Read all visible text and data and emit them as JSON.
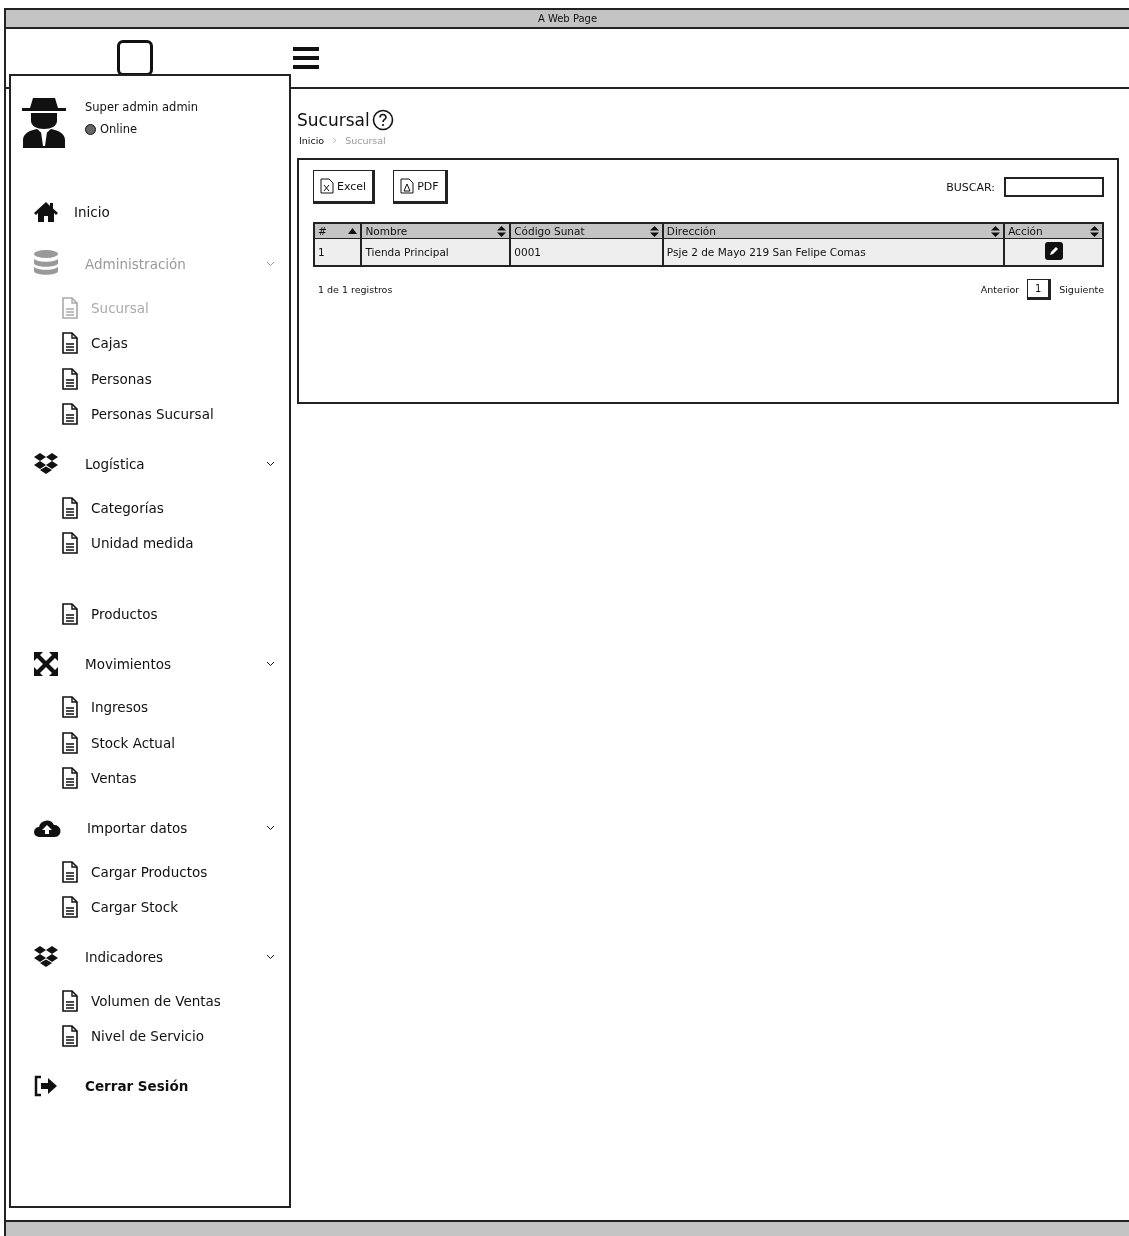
{
  "window": {
    "title": "A Web Page"
  },
  "user": {
    "name": "Super admin admin",
    "status": "Online"
  },
  "sidebar": {
    "items": [
      {
        "kind": "link",
        "label": "Inicio"
      },
      {
        "kind": "group",
        "label": "Administración",
        "selected": true,
        "children": [
          {
            "label": "Sucursal",
            "selected": true
          },
          {
            "label": "Cajas",
            "selected": false
          },
          {
            "label": "Personas",
            "selected": false
          },
          {
            "label": "Personas Sucursal",
            "selected": false
          }
        ]
      },
      {
        "kind": "group",
        "label": "Logística",
        "selected": false,
        "children": [
          {
            "label": "Categorías",
            "selected": false
          },
          {
            "label": "Unidad medida",
            "selected": false
          },
          {
            "label": "Productos",
            "selected": false
          }
        ]
      },
      {
        "kind": "group",
        "label": "Movimientos",
        "selected": false,
        "children": [
          {
            "label": "Ingresos",
            "selected": false
          },
          {
            "label": "Stock Actual",
            "selected": false
          },
          {
            "label": "Ventas",
            "selected": false
          }
        ]
      },
      {
        "kind": "group",
        "label": "Importar datos",
        "selected": false,
        "children": [
          {
            "label": "Cargar Productos",
            "selected": false
          },
          {
            "label": "Cargar Stock",
            "selected": false
          }
        ]
      },
      {
        "kind": "group",
        "label": "Indicadores",
        "selected": false,
        "children": [
          {
            "label": "Volumen de Ventas",
            "selected": false
          },
          {
            "label": "Nivel de Servicio",
            "selected": false
          }
        ]
      },
      {
        "kind": "link",
        "label": "Cerrar Sesión"
      }
    ]
  },
  "page": {
    "title": "Sucursal",
    "breadcrumb": [
      "Inicio",
      "Sucursal"
    ]
  },
  "toolbar": {
    "buttons": [
      {
        "label": "Excel"
      },
      {
        "label": "PDF"
      }
    ],
    "search": {
      "label": "BUSCAR:"
    }
  },
  "table": {
    "columns": [
      {
        "label": "#",
        "sorted": true
      },
      {
        "label": "Nombre",
        "sorted": false
      },
      {
        "label": "Código Sunat",
        "sorted": false
      },
      {
        "label": "Dirección",
        "sorted": false
      },
      {
        "label": "Acción",
        "sorted": false
      }
    ],
    "rows": [
      {
        "cells": [
          "1",
          "Tienda Principal",
          "0001",
          "Psje 2 de Mayo 219 San Felipe Comas"
        ]
      }
    ]
  },
  "footer": {
    "info": "1 de 1 registros",
    "previous": "Anterior",
    "pages": [
      {
        "label": "1",
        "selected": true
      }
    ],
    "next": "Siguiente"
  }
}
